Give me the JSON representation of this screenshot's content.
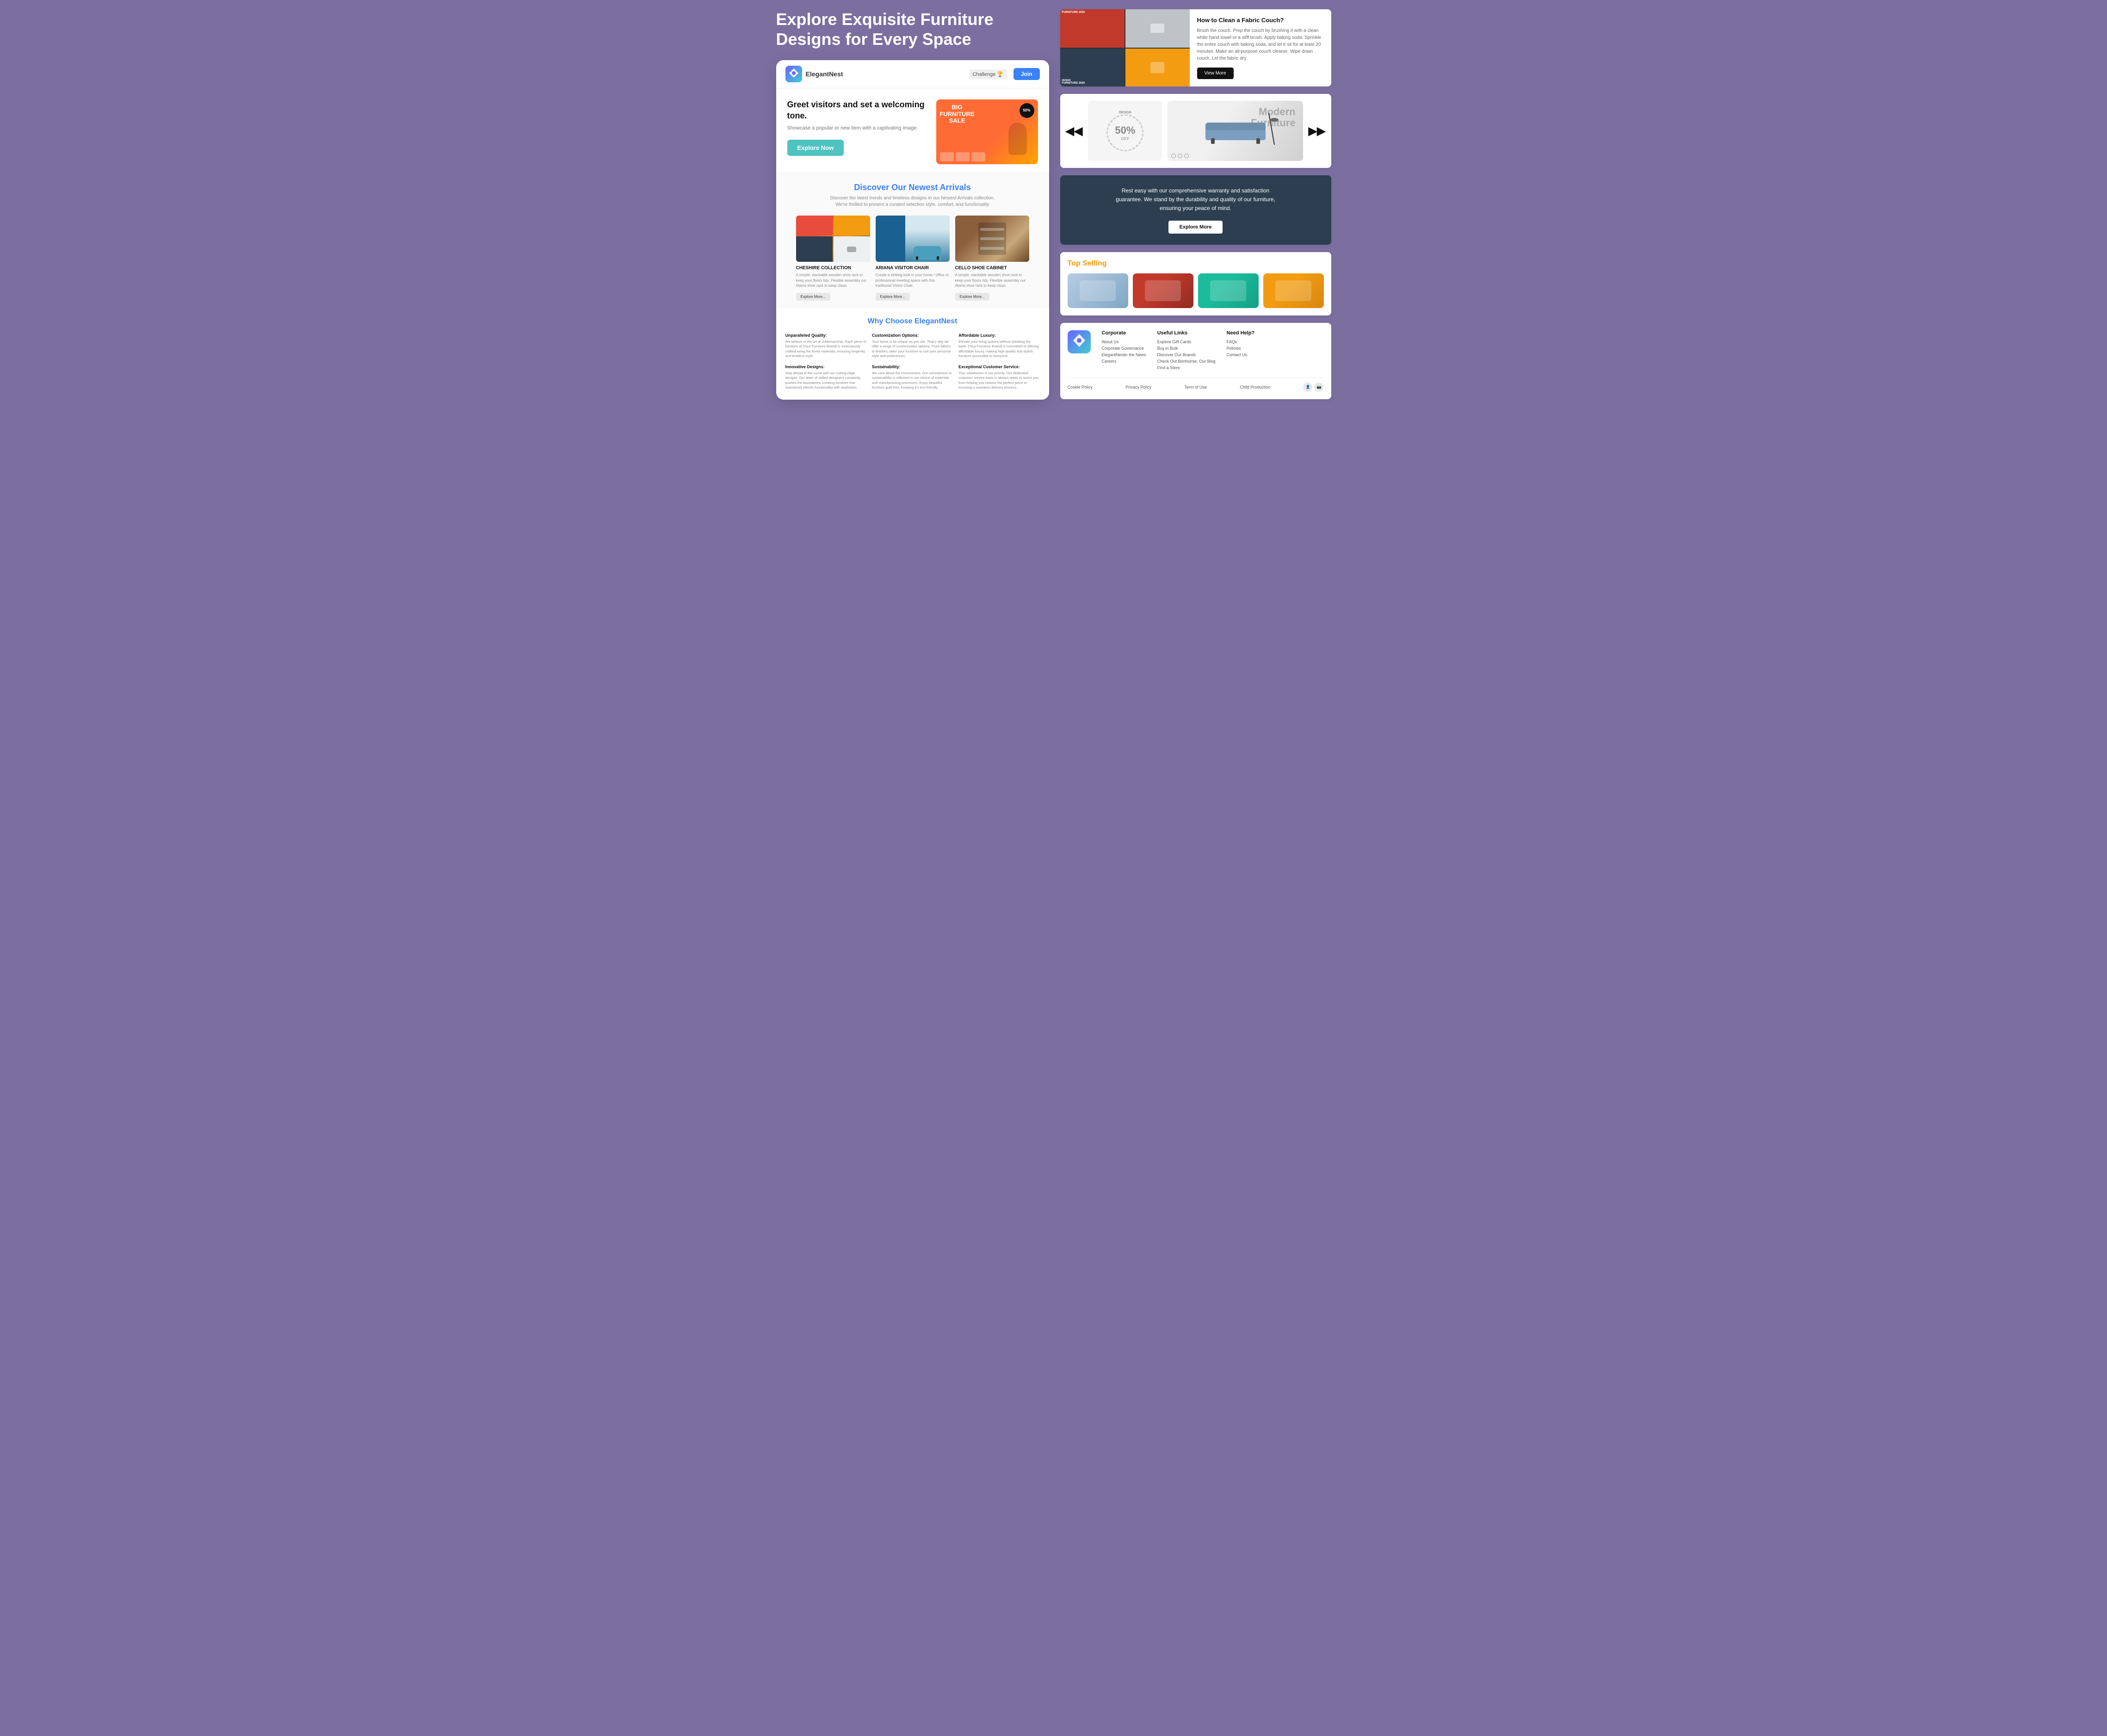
{
  "hero": {
    "title": "Explore Exquisite Furniture Designs for Every Space"
  },
  "nav": {
    "logo_text": "ElegantNest",
    "challenge_label": "Challenge 🏆",
    "join_label": "Join"
  },
  "hero_section": {
    "tagline": "Greet visitors and set a welcoming tone.",
    "subtitle": "Showcase a popular or new item with a captivating image.",
    "explore_btn": "Explore Now",
    "sale_badge": "50%",
    "sale_title": "BIG FURNITURE SALE"
  },
  "arrivals": {
    "title_static": "Discover Our ",
    "title_highlight": "Newest Arrivals",
    "subtitle": "Discover the latest trends and timeless designs in our Newest Arrivals collection. We're thrilled to present a curated selection  style, comfort, and functionality",
    "products": [
      {
        "name": "Cheshire Collection",
        "desc": "A simple, stackable wooden shoe rack to keep your floors tidy. Flexible assembly our Alama shoe rack to keep clean.",
        "btn": "Explore More..."
      },
      {
        "name": "Ariana Visitor Chair",
        "desc": "Create a striking look in your home / office or professional meeting space with this traditional Visitor Chair.",
        "btn": "Explore More..."
      },
      {
        "name": "Cello Shoe Cabinet",
        "desc": "A simple, stackable wooden shoe rack to keep your floors tidy. Flexible assembly our Alama shoe rack to keep clean.",
        "btn": "Explore More..."
      }
    ]
  },
  "why_choose": {
    "title_static": "Why Choose ",
    "title_highlight": "ElegantNest",
    "items": [
      {
        "title": "Unparalleled Quality:",
        "desc": "We believe in the art of craftsmanship. Each piece of furniture at [Your Furniture Brand] is meticulously crafted using the finest materials, ensuring longevity and timeless style."
      },
      {
        "title": "Customization Options:",
        "desc": "Your home is as unique as you are. That's why we offer a range of customization options. From fabrics to finishes, tailor your furniture to suit your personal style and preferences."
      },
      {
        "title": "Affordable Luxury:",
        "desc": "Elevate your living spaces without breaking the bank. [Your Furniture Brand] is committed to offering affordable luxury, making high-quality and stylish furniture accessible to everyone."
      },
      {
        "title": "Innovative Designs:",
        "desc": "Stay ahead of the curve with our cutting-edge designs. Our team of skilled designers constantly pushes the boundaries, creating furniture that seamlessly blends functionality with aesthetics."
      },
      {
        "title": "Sustainability:",
        "desc": "We care about the environment. Our commitment to sustainability is reflected in our choice of materials and manufacturing processes. Enjoy beautiful furniture guilt-free, knowing it's eco-friendly."
      },
      {
        "title": "Exceptional Customer Service:",
        "desc": "Your satisfaction is our priority. Our dedicated customer service team is always ready to assist you, from helping you choose the perfect piece to ensuring a seamless delivery process."
      }
    ]
  },
  "article": {
    "heading": "How to Clean a Fabric Couch?",
    "body": "Brush the couch. Prep the couch by brushing it with a clean white hand towel or a stiff brush. Apply baking soda. Sprinkle the entire couch with baking soda, and let it sit for at least 20 minutes. Make an all-purpose couch cleaner. Wipe down couch. Let the fabric dry",
    "view_more_btn": "View More"
  },
  "carousel": {
    "discount": "50%",
    "discount_off": "OFF",
    "modern_furniture": "Modern\nFurniture",
    "prev_icon": "◀◀",
    "next_icon": "▶▶"
  },
  "warranty": {
    "text": "Rest easy with our comprehensive warranty and satisfaction guarantee. We stand by the durability and quality of our furniture, ensuring your peace of mind.",
    "btn": "Explore More"
  },
  "top_selling": {
    "title_static": "Top ",
    "title_highlight": "Selling"
  },
  "footer": {
    "columns": [
      {
        "heading": "Corporate",
        "links": [
          "About Us",
          "Corporate Governance",
          "ElegantNestin the News",
          "Careers"
        ]
      },
      {
        "heading": "Useful Links",
        "links": [
          "Explore Gift Cards",
          "Buy in Bulk",
          "Discover Our Brands",
          "Check Out Bonhomie, Our Blog",
          "Find a Store"
        ]
      },
      {
        "heading": "Need Help?",
        "links": [
          "FAQs",
          "Policies",
          "Contact Us"
        ]
      }
    ],
    "bottom_links": [
      "Cookie Policy",
      "Privacy Policy",
      "Term of Use",
      "Child Production"
    ]
  }
}
